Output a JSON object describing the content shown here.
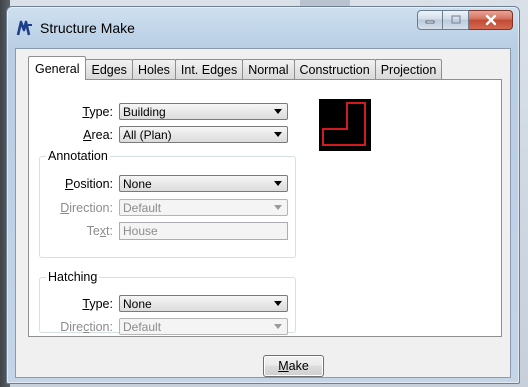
{
  "window": {
    "title": "Structure Make",
    "icon": "app-logo-icon"
  },
  "tabs": [
    {
      "label": "General",
      "active": true
    },
    {
      "label": "Edges"
    },
    {
      "label": "Holes"
    },
    {
      "label": "Int. Edges"
    },
    {
      "label": "Normal"
    },
    {
      "label": "Construction"
    },
    {
      "label": "Projection"
    }
  ],
  "general": {
    "type": {
      "label_pre": "",
      "label_u": "T",
      "label_post": "ype:",
      "value": "Building"
    },
    "area": {
      "label_pre": "",
      "label_u": "A",
      "label_post": "rea:",
      "value": "All (Plan)"
    }
  },
  "annotation": {
    "title": "Annotation",
    "position": {
      "label_pre": "",
      "label_u": "P",
      "label_post": "osition:",
      "value": "None"
    },
    "direction": {
      "label_pre": "",
      "label_u": "D",
      "label_post": "irection:",
      "value": "Default"
    },
    "text": {
      "label_pre": "Te",
      "label_u": "x",
      "label_post": "t:",
      "value": "House"
    }
  },
  "hatching": {
    "title": "Hatching",
    "type": {
      "label_pre": "",
      "label_u": "T",
      "label_post": "ype:",
      "value": "None"
    },
    "direction": {
      "label_pre": "Dire",
      "label_u": "c",
      "label_post": "tion:",
      "value": "Default"
    }
  },
  "make_button": {
    "label_u": "M",
    "label_post": "ake"
  },
  "colors": {
    "preview_outline": "#d01c1c",
    "preview_bg": "#000000"
  }
}
